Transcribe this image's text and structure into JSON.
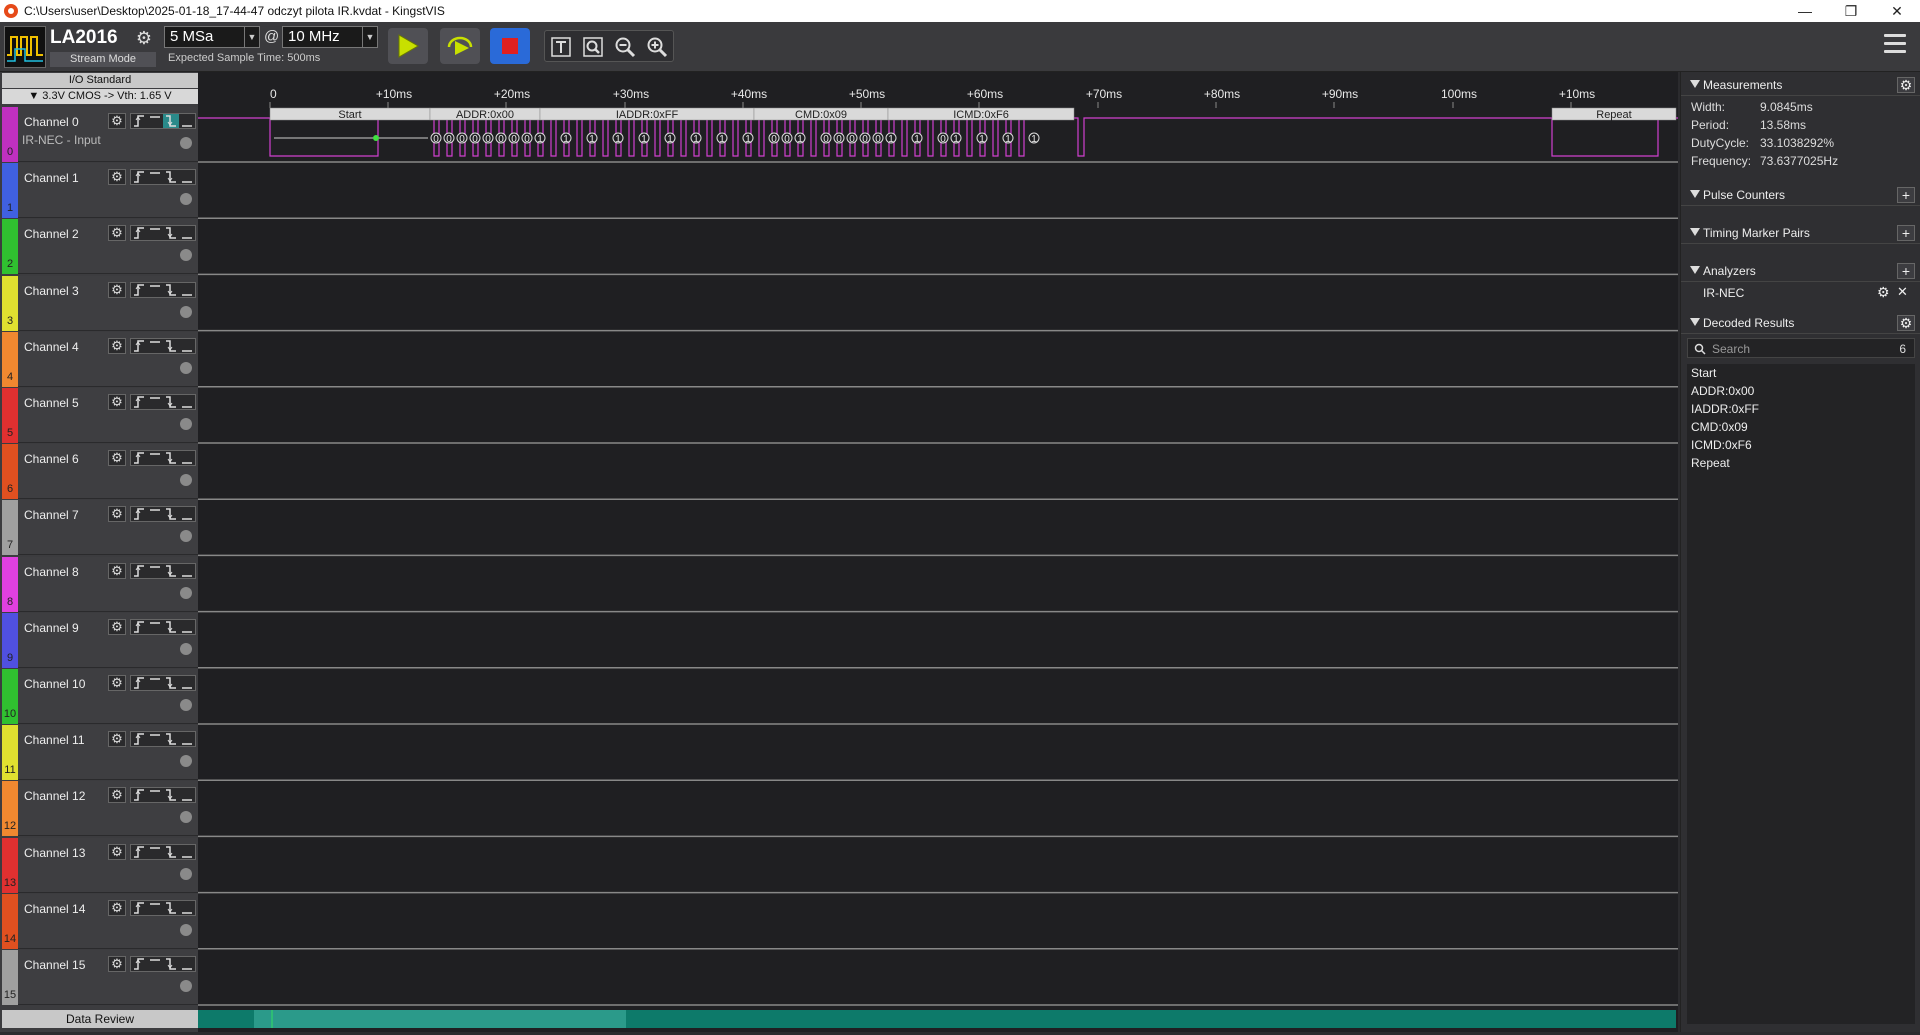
{
  "window": {
    "title": "C:\\Users\\user\\Desktop\\2025-01-18_17-44-47 odczyt pilota IR.kvdat - KingstVIS"
  },
  "toolbar": {
    "device": "LA2016",
    "mode": "Stream Mode",
    "sample_count": "5 MSa",
    "at": "@",
    "sample_rate": "10 MHz",
    "expected_time": "Expected Sample Time: 500ms",
    "colors": {
      "start": "#c8e000",
      "stop": "#e02020"
    }
  },
  "io": {
    "header": "I/O Standard",
    "value": "▼  3.3V CMOS -> Vth: 1.65 V"
  },
  "channels": [
    {
      "name": "Channel 0",
      "num": "0",
      "sub": "IR-NEC - Input",
      "color": "#c030c0"
    },
    {
      "name": "Channel 1",
      "num": "1",
      "sub": "",
      "color": "#4060e0"
    },
    {
      "name": "Channel 2",
      "num": "2",
      "sub": "",
      "color": "#30c030"
    },
    {
      "name": "Channel 3",
      "num": "3",
      "sub": "",
      "color": "#e0e030"
    },
    {
      "name": "Channel 4",
      "num": "4",
      "sub": "",
      "color": "#f08830"
    },
    {
      "name": "Channel 5",
      "num": "5",
      "sub": "",
      "color": "#e03030"
    },
    {
      "name": "Channel 6",
      "num": "6",
      "sub": "",
      "color": "#e05020"
    },
    {
      "name": "Channel 7",
      "num": "7",
      "sub": "",
      "color": "#a0a0a0"
    },
    {
      "name": "Channel 8",
      "num": "8",
      "sub": "",
      "color": "#e040e0"
    },
    {
      "name": "Channel 9",
      "num": "9",
      "sub": "",
      "color": "#5050e0"
    },
    {
      "name": "Channel 10",
      "num": "10",
      "sub": "",
      "color": "#30c030"
    },
    {
      "name": "Channel 11",
      "num": "11",
      "sub": "",
      "color": "#e0e030"
    },
    {
      "name": "Channel 12",
      "num": "12",
      "sub": "",
      "color": "#f08830"
    },
    {
      "name": "Channel 13",
      "num": "13",
      "sub": "",
      "color": "#e03030"
    },
    {
      "name": "Channel 14",
      "num": "14",
      "sub": "",
      "color": "#e05020"
    },
    {
      "name": "Channel 15",
      "num": "15",
      "sub": "",
      "color": "#a0a0a0"
    }
  ],
  "data_review": "Data Review",
  "timeline": {
    "ticks": [
      "0",
      "+10ms",
      "+20ms",
      "+30ms",
      "+40ms",
      "+50ms",
      "+60ms",
      "+70ms",
      "+80ms",
      "+90ms",
      "100ms",
      "+10ms"
    ],
    "decode_labels": [
      "Start",
      "ADDR:0x00",
      "IADDR:0xFF",
      "CMD:0x09",
      "ICMD:0xF6",
      "Repeat"
    ],
    "addr_bits": "00000000",
    "iaddr_bits": "11111111",
    "cmd_bits": "1001",
    "cmd_bits2": "0000",
    "icmd_bits": "0110",
    "icmd_bits2": "1111"
  },
  "measurements": {
    "title": "Measurements",
    "items": [
      {
        "k": "Width:",
        "v": "9.0845ms"
      },
      {
        "k": "Period:",
        "v": "13.58ms"
      },
      {
        "k": "DutyCycle:",
        "v": "33.1038292%"
      },
      {
        "k": "Frequency:",
        "v": "73.6377025Hz"
      }
    ]
  },
  "panels": {
    "pulse_counters": "Pulse Counters",
    "timing_markers": "Timing Marker Pairs",
    "analyzers": "Analyzers",
    "analyzer_item": "IR-NEC",
    "decoded_results": "Decoded Results",
    "search_placeholder": "Search",
    "result_count": "6",
    "results": [
      "Start",
      "ADDR:0x00",
      "IADDR:0xFF",
      "CMD:0x09",
      "ICMD:0xF6",
      "Repeat"
    ]
  }
}
